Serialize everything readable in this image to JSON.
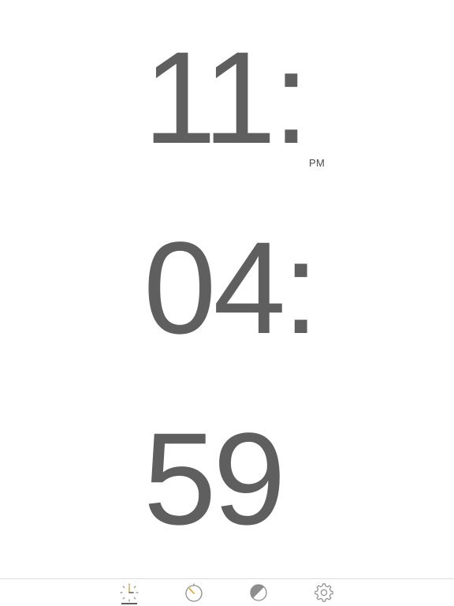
{
  "clock": {
    "hours": "11:",
    "minutes": "04:",
    "seconds": "59",
    "period": "PM"
  },
  "tabbar": {
    "tabs": [
      {
        "icon": "clock-icon",
        "active": true
      },
      {
        "icon": "timer-icon",
        "active": false
      },
      {
        "icon": "theme-icon",
        "active": false
      },
      {
        "icon": "gear-icon",
        "active": false
      }
    ],
    "accent": "#f0a830",
    "icon_color": "#8e8e8e"
  }
}
